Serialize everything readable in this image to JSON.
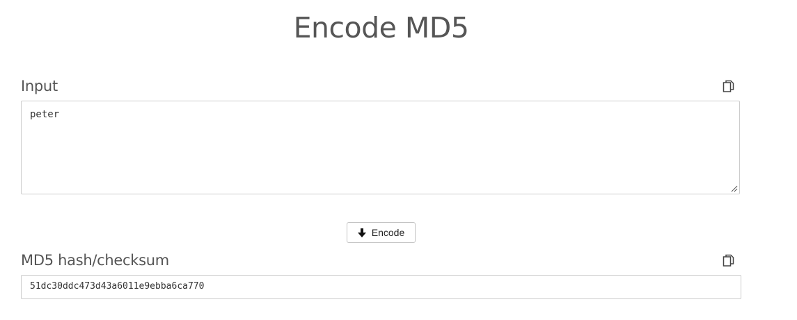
{
  "page": {
    "title": "Encode MD5"
  },
  "input": {
    "label": "Input",
    "value": "peter",
    "copy_icon": "copy-icon"
  },
  "action": {
    "encode_label": "Encode",
    "icon": "arrow-down-icon"
  },
  "output": {
    "label": "MD5 hash/checksum",
    "value": "51dc30ddc473d43a6011e9ebba6ca770",
    "copy_icon": "copy-icon"
  }
}
